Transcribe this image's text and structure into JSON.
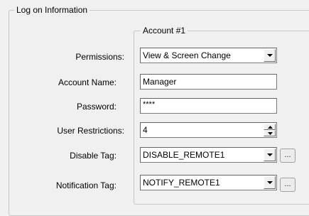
{
  "outer_group": {
    "title": "Log on Information"
  },
  "account_group": {
    "title": "Account #1"
  },
  "fields": {
    "permissions": {
      "label": "Permissions:",
      "value": "View & Screen Change"
    },
    "account_name": {
      "label": "Account Name:",
      "value": "Manager"
    },
    "password": {
      "label": "Password:",
      "value": "****"
    },
    "user_restrictions": {
      "label": "User Restrictions:",
      "value": "4"
    },
    "disable_tag": {
      "label": "Disable Tag:",
      "value": "DISABLE_REMOTE1",
      "browse_label": "..."
    },
    "notification_tag": {
      "label": "Notification Tag:",
      "value": "NOTIFY_REMOTE1",
      "browse_label": "..."
    }
  }
}
